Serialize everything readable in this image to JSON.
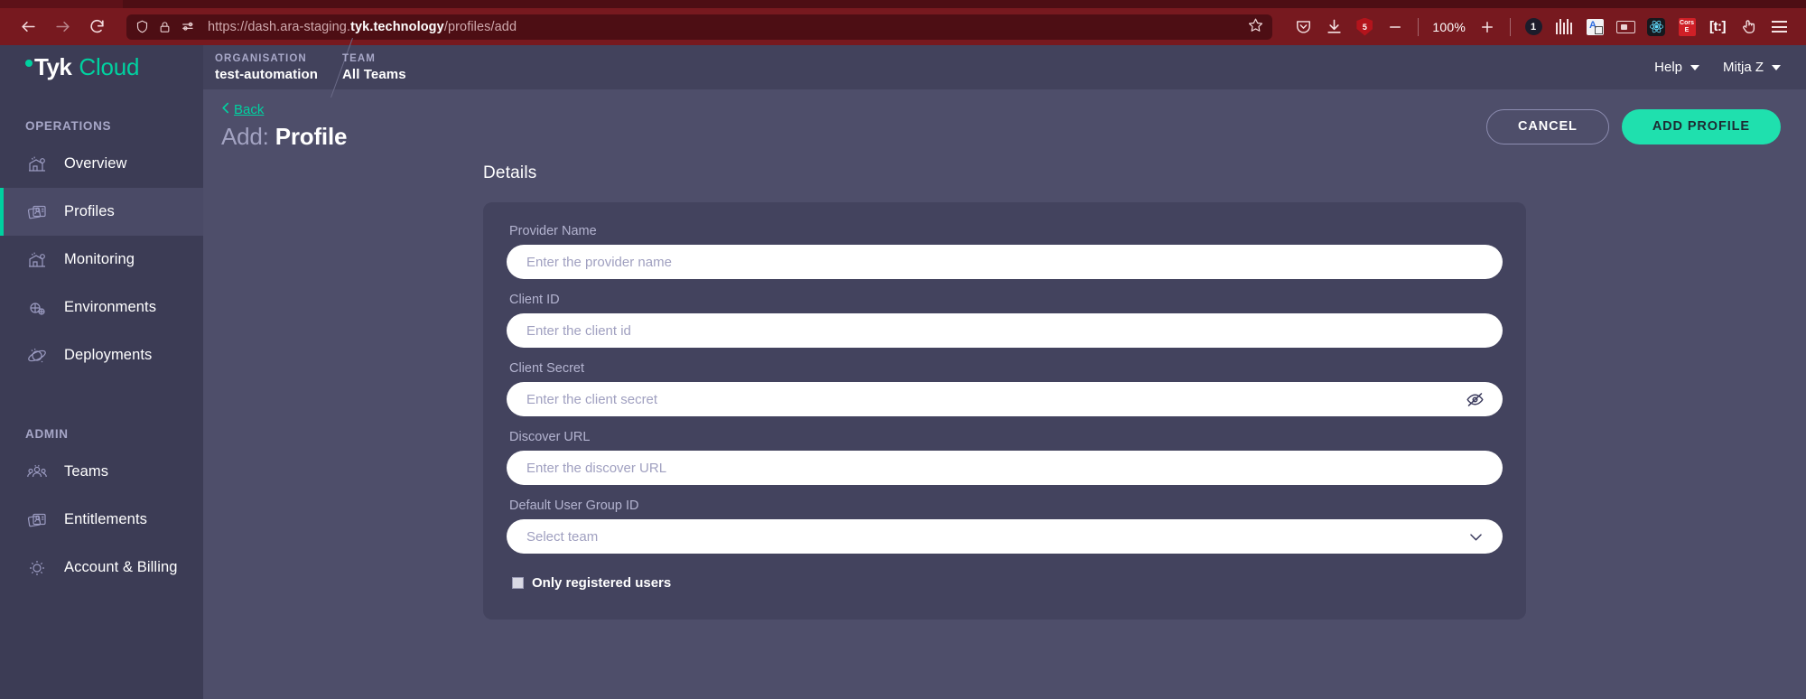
{
  "browser": {
    "nav": {
      "back_icon": "arrow-left-icon",
      "forward_icon": "arrow-right-icon",
      "reload_icon": "reload-icon"
    },
    "urlbar": {
      "shield_icon": "shield-icon",
      "lock_icon": "lock-icon",
      "permissions_icon": "page-options-icon",
      "url_scheme": "https://",
      "url_prefix": "dash.ara-staging.",
      "url_host_strong": "tyk.technology",
      "url_path": "/profiles/add",
      "full_url": "https://dash.ara-staging.tyk.technology/profiles/add",
      "bookmark_icon": "star-icon"
    },
    "toolbar_right": {
      "pocket_icon": "pocket-icon",
      "downloads_icon": "download-icon",
      "ublock_label": "5",
      "minimize_icon": "minimize-icon",
      "zoom_level": "100%",
      "zoom_in_icon": "plus-icon",
      "counter_badge": "1",
      "grip_icon": "columns-icon",
      "translate_icon": "translate-icon",
      "screenshot_icon": "camera-icon",
      "react_icon": "react-devtools-icon",
      "cors_label_top": "Cors",
      "cors_label_bottom": "E",
      "tt_label": "[t:]",
      "pointer_icon": "hand-pointer-icon",
      "menu_icon": "hamburger-menu-icon"
    }
  },
  "sidebar": {
    "brand": {
      "name": "Tyk",
      "suffix": "Cloud"
    },
    "sections": [
      {
        "title": "OPERATIONS",
        "items": [
          {
            "label": "Overview",
            "icon": "overview-icon",
            "active": false
          },
          {
            "label": "Profiles",
            "icon": "profiles-icon",
            "active": true
          },
          {
            "label": "Monitoring",
            "icon": "monitoring-icon",
            "active": false
          },
          {
            "label": "Environments",
            "icon": "environments-icon",
            "active": false
          },
          {
            "label": "Deployments",
            "icon": "deployments-icon",
            "active": false
          }
        ]
      },
      {
        "title": "ADMIN",
        "items": [
          {
            "label": "Teams",
            "icon": "teams-icon",
            "active": false
          },
          {
            "label": "Entitlements",
            "icon": "entitlements-icon",
            "active": false
          },
          {
            "label": "Account & Billing",
            "icon": "account-billing-icon",
            "active": false
          }
        ]
      }
    ]
  },
  "topbar": {
    "breadcrumbs": [
      {
        "kicker": "ORGANISATION",
        "value": "test-automation"
      },
      {
        "kicker": "TEAM",
        "value": "All Teams"
      }
    ],
    "help_label": "Help",
    "user_label": "Mitja Z"
  },
  "page": {
    "back_label": "Back",
    "title_prefix": "Add:",
    "title_main": "Profile",
    "cancel_label": "CANCEL",
    "submit_label": "ADD PROFILE"
  },
  "form": {
    "section_title": "Details",
    "fields": [
      {
        "label": "Provider Name",
        "placeholder": "Enter the provider name",
        "value": "",
        "type": "text"
      },
      {
        "label": "Client ID",
        "placeholder": "Enter the client id",
        "value": "",
        "type": "text"
      },
      {
        "label": "Client Secret",
        "placeholder": "Enter the client secret",
        "value": "",
        "type": "password",
        "adorn_icon": "eye-off-icon"
      },
      {
        "label": "Discover URL",
        "placeholder": "Enter the discover URL",
        "value": "",
        "type": "text"
      },
      {
        "label": "Default User Group ID",
        "placeholder": "Select team",
        "value": "",
        "type": "select",
        "adorn_icon": "chevron-down-icon"
      }
    ],
    "checkbox": {
      "label": "Only registered users",
      "checked": false
    }
  },
  "colors": {
    "accent": "#00d1a0",
    "primary_button": "#1fe0ae",
    "sidebar_bg": "#3c3c55",
    "app_bg": "#4e4e6a",
    "card_bg": "#43435e",
    "browser_chrome": "#77191f"
  }
}
